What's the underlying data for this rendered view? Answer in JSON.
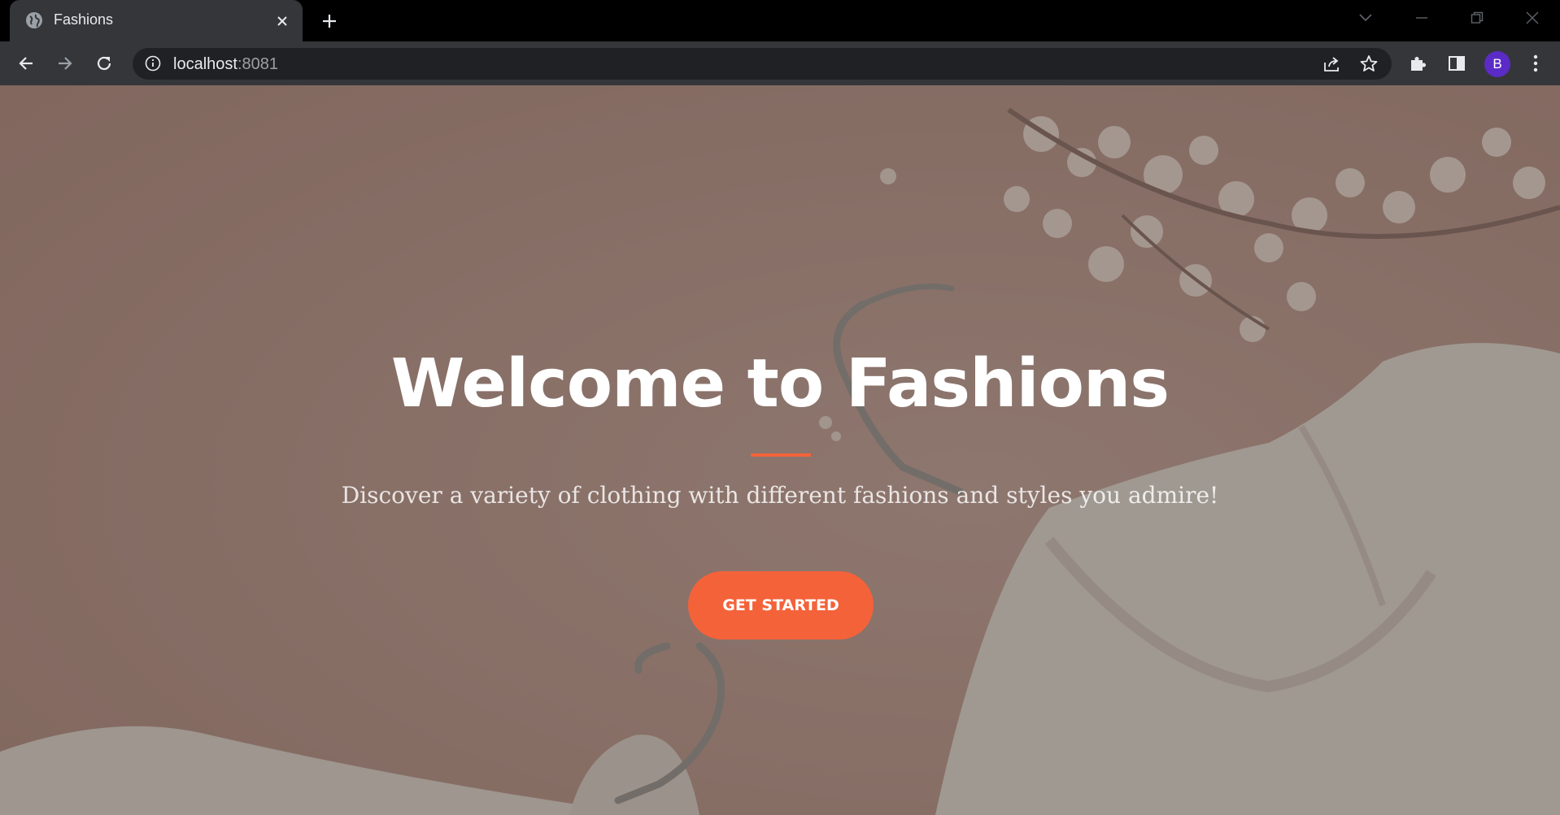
{
  "browser": {
    "tab_title": "Fashions",
    "url_host": "localhost",
    "url_port": ":8081",
    "profile_initial": "B"
  },
  "hero": {
    "title": "Welcome to Fashions",
    "subtitle": "Discover a variety of clothing with different fashions and styles you admire!",
    "cta_label": "GET STARTED"
  },
  "colors": {
    "accent": "#f4623a",
    "chrome_dark": "#35363a",
    "page_background": "#b99085"
  }
}
